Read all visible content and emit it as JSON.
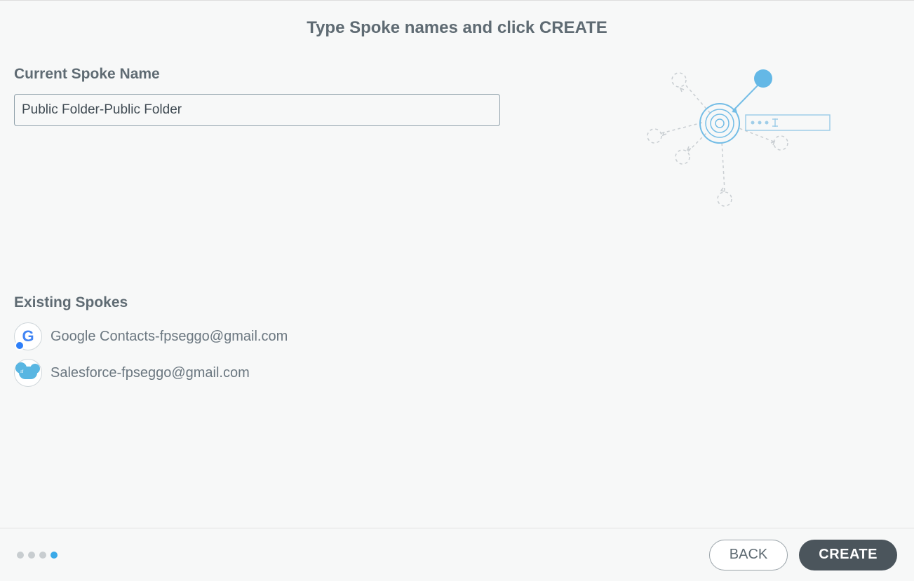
{
  "header": {
    "title": "Type Spoke names and click CREATE"
  },
  "form": {
    "current_label": "Current Spoke Name",
    "current_value": "Public Folder-Public Folder"
  },
  "existing": {
    "heading": "Existing Spokes",
    "items": [
      {
        "icon": "google",
        "label": "Google Contacts-fpseggo@gmail.com"
      },
      {
        "icon": "salesforce",
        "label": "Salesforce-fpseggo@gmail.com"
      }
    ]
  },
  "footer": {
    "steps_total": 4,
    "step_active": 4,
    "back_label": "BACK",
    "create_label": "CREATE"
  },
  "colors": {
    "accent": "#3aa9e8",
    "button_dark": "#4b555c"
  }
}
